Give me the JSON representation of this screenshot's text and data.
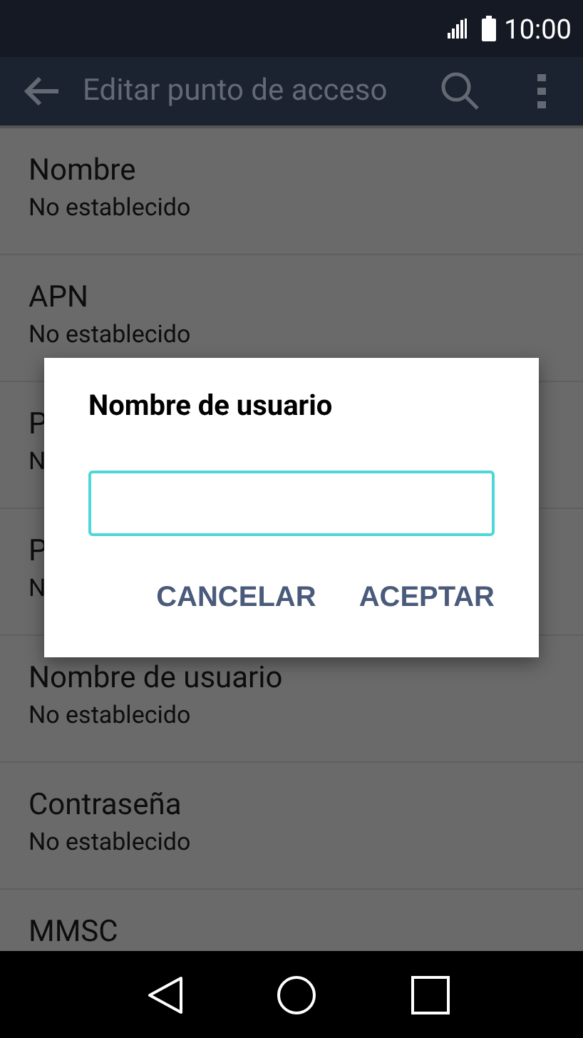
{
  "status_bar": {
    "time": "10:00"
  },
  "app_bar": {
    "title": "Editar punto de acceso"
  },
  "settings": [
    {
      "title": "Nombre",
      "value": "No establecido"
    },
    {
      "title": "APN",
      "value": "No establecido"
    },
    {
      "title": "P",
      "value": "N"
    },
    {
      "title": "P",
      "value": "N"
    },
    {
      "title": "Nombre de usuario",
      "value": "No establecido"
    },
    {
      "title": "Contraseña",
      "value": "No establecido"
    },
    {
      "title": "MMSC"
    }
  ],
  "dialog": {
    "title": "Nombre de usuario",
    "field": {
      "focused": true
    },
    "buttons": [
      "CANCELAR",
      "ACEPTAR"
    ]
  }
}
